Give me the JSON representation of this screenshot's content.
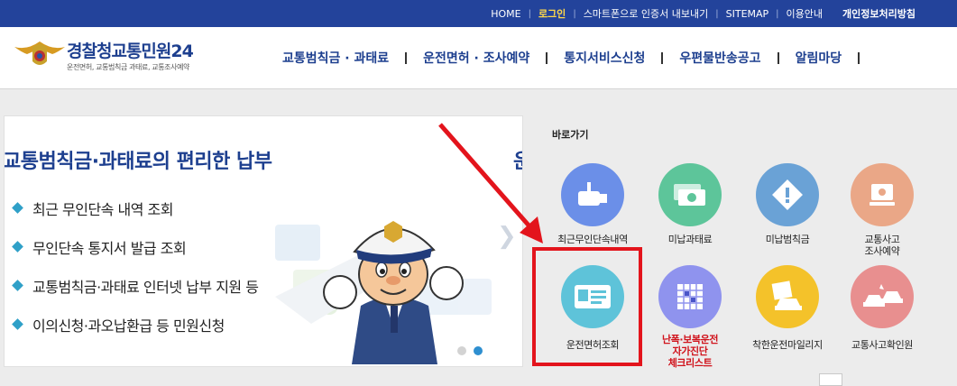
{
  "topbar": {
    "links": [
      "HOME",
      "로그인",
      "스마트폰으로 인증서 내보내기",
      "SITEMAP",
      "이용안내"
    ],
    "privacy": "개인정보처리방침"
  },
  "logo": {
    "title_1": "경찰청",
    "title_2": "교통민원24",
    "subtitle": "운전면허, 교통범칙금 과태료, 교통조사예약"
  },
  "nav": {
    "items": [
      "교통범칙금 · 과태료",
      "운전면허 · 조사예약",
      "통지서비스신청",
      "우편물반송공고",
      "알림마당"
    ]
  },
  "banner": {
    "title": "교통범칙금·과태료의 편리한 납부",
    "title_next": "운",
    "items": [
      "최근 무인단속 내역 조회",
      "무인단속 통지서 발급 조회",
      "교통범칙금·과태료 인터넷 납부 지원 등",
      "이의신청·과오납환급 등 민원신청"
    ]
  },
  "quick": {
    "title": "바로가기",
    "items": [
      {
        "label": "최근무인단속내역",
        "color": "#6b8fe8",
        "icon": "camera-icon"
      },
      {
        "label": "미납과태료",
        "color": "#5dc59a",
        "icon": "money-icon"
      },
      {
        "label": "미납범칙금",
        "color": "#6aa2d6",
        "icon": "warning-icon"
      },
      {
        "label": "교통사고\n조사예약",
        "color": "#eaa787",
        "icon": "computer-icon"
      },
      {
        "label": "운전면허조회",
        "color": "#5ec3d9",
        "icon": "license-card-icon"
      },
      {
        "label": "난폭·보복운전\n자가진단\n체크리스트",
        "color": "#8f93ee",
        "icon": "checklist-icon"
      },
      {
        "label": "착한운전마일리지",
        "color": "#f4c22a",
        "icon": "mileage-icon"
      },
      {
        "label": "교통사고확인원",
        "color": "#e88f8f",
        "icon": "car-crash-icon"
      }
    ]
  }
}
